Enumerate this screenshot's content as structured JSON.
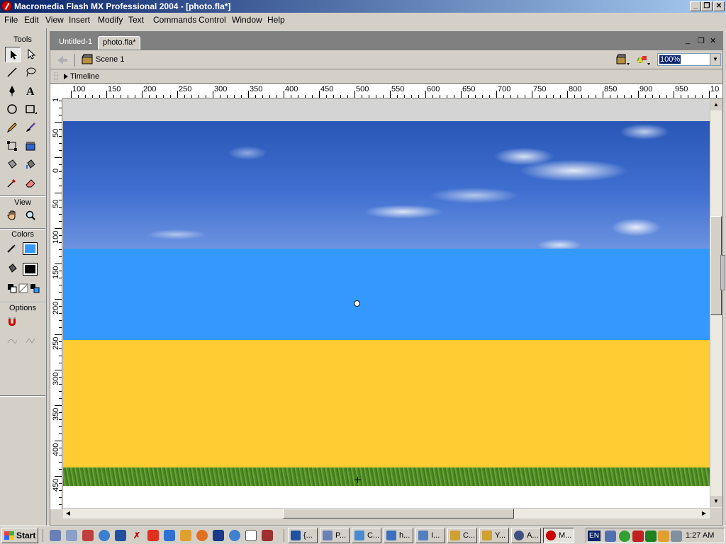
{
  "window": {
    "title": "Macromedia Flash MX Professional 2004 - [photo.fla*]",
    "controls": {
      "minimize": "_",
      "restore": "❐",
      "close": "✕"
    }
  },
  "menu": [
    "File",
    "Edit",
    "View",
    "Insert",
    "Modify",
    "Text",
    "Commands",
    "Control",
    "Window",
    "Help"
  ],
  "tools_panel": {
    "section_tools": "Tools",
    "section_view": "View",
    "section_colors": "Colors",
    "section_options": "Options",
    "stroke_color": "#000000",
    "fill_color": "#3399ff"
  },
  "document": {
    "tabs": [
      "Untitled-1",
      "photo.fla*"
    ],
    "active_tab": "photo.fla*",
    "scene": "Scene 1",
    "zoom": "100%",
    "timeline_label": "Timeline"
  },
  "rulers": {
    "horizontal_labels": [
      "100",
      "150",
      "200",
      "250",
      "300",
      "350",
      "400",
      "450",
      "500",
      "550",
      "600",
      "650",
      "700",
      "750",
      "800",
      "850",
      "900",
      "950",
      "10"
    ],
    "vertical_labels": [
      "100",
      "50",
      "0",
      "50",
      "100",
      "150",
      "200",
      "250",
      "300",
      "350",
      "400",
      "450"
    ]
  },
  "stage": {
    "colors": {
      "background": "#d4d4d4",
      "blue_band": "#3399ff",
      "yellow_band": "#ffcc33",
      "white": "#ffffff"
    }
  },
  "taskbar": {
    "start_label": "Start",
    "tasks": [
      "{...",
      "P...",
      "C...",
      "h...",
      "I...",
      "C...",
      "Y...",
      "A...",
      "M..."
    ],
    "active_task": "M...",
    "language": "EN",
    "clock": "1:27 AM"
  }
}
